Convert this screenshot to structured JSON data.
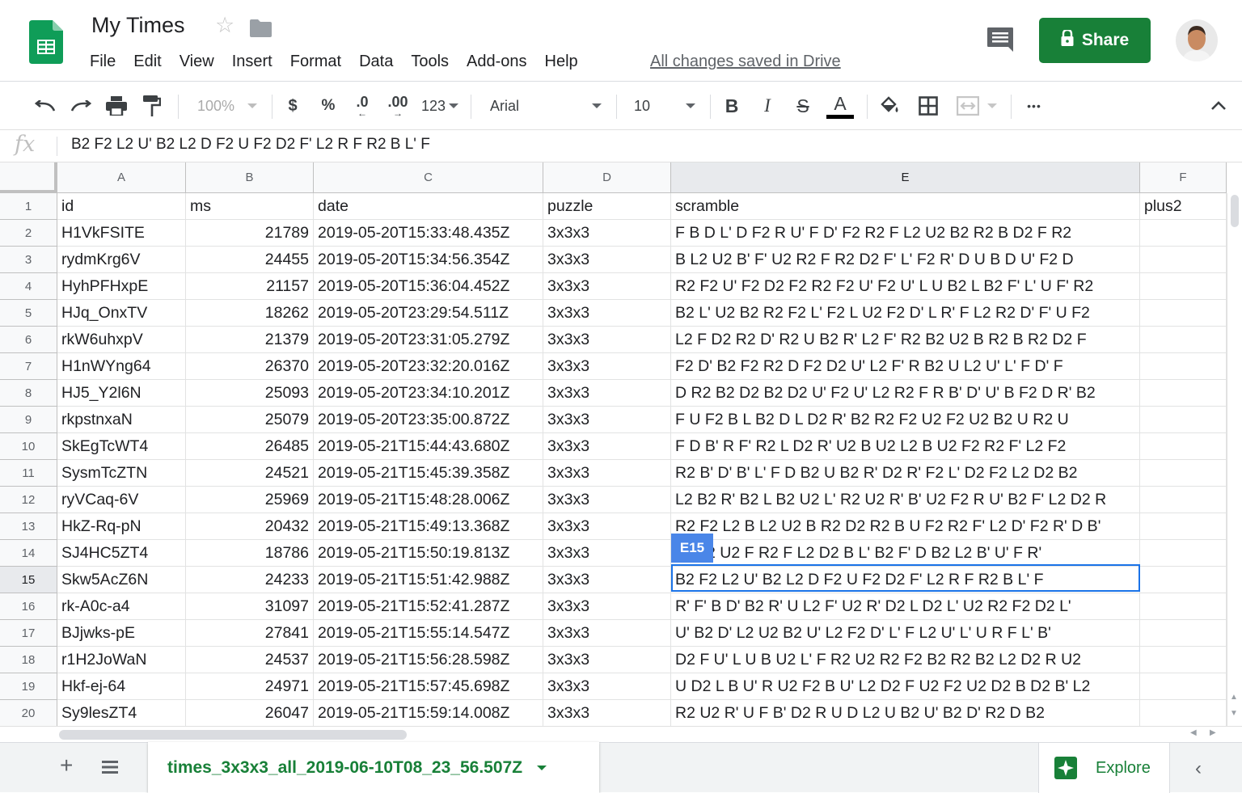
{
  "app": {
    "title": "My Times",
    "menu": [
      "File",
      "Edit",
      "View",
      "Insert",
      "Format",
      "Data",
      "Tools",
      "Add-ons",
      "Help"
    ],
    "saved_status": "All changes saved in Drive",
    "share_label": "Share",
    "colors": {
      "brand_green": "#188038",
      "selection_blue": "#1a73e8",
      "cell_tag_blue": "#4a86e8"
    }
  },
  "toolbar": {
    "zoom": "100%",
    "currency": "$",
    "percent": "%",
    "decrease_decimal": ".0",
    "increase_decimal": ".00",
    "more_formats": "123",
    "font": "Arial",
    "font_size": "10",
    "bold": "B",
    "italic": "I",
    "strikethrough": "S",
    "text_color": "A",
    "more": "•••"
  },
  "formula_bar": {
    "fx": "fx",
    "value": "B2 F2 L2 U' B2 L2 D F2 U F2 D2 F' L2 R F R2 B L' F"
  },
  "grid": {
    "columns": [
      "A",
      "B",
      "C",
      "D",
      "E",
      "F"
    ],
    "row_numbers": [
      "1",
      "2",
      "3",
      "4",
      "5",
      "6",
      "7",
      "8",
      "9",
      "10",
      "11",
      "12",
      "13",
      "14",
      "15",
      "16",
      "17",
      "18",
      "19",
      "20"
    ],
    "active_cell": "E15",
    "rows": [
      [
        "id",
        "ms",
        "date",
        "puzzle",
        "scramble",
        "plus2"
      ],
      [
        "H1VkFSITE",
        "21789",
        "2019-05-20T15:33:48.435Z",
        "3x3x3",
        "F B D L' D F2 R U' F D' F2 R2 F L2 U2 B2 R2 B D2 F R2",
        ""
      ],
      [
        "rydmKrg6V",
        "24455",
        "2019-05-20T15:34:56.354Z",
        "3x3x3",
        "B L2 U2 B' F' U2 R2 F R2 D2 F' L' F2 R' D U B D U' F2 D",
        ""
      ],
      [
        "HyhPFHxpE",
        "21157",
        "2019-05-20T15:36:04.452Z",
        "3x3x3",
        "R2 F2 U' F2 D2 F2 R2 F2 U' F2 U' L U B2 L B2 F' L' U F' R2",
        ""
      ],
      [
        "HJq_OnxTV",
        "18262",
        "2019-05-20T23:29:54.511Z",
        "3x3x3",
        "B2 L' U2 B2 R2 F2 L' F2 L U2 F2 D' L R' F L2 R2 D' F' U F2",
        ""
      ],
      [
        "rkW6uhxpV",
        "21379",
        "2019-05-20T23:31:05.279Z",
        "3x3x3",
        "L2 F D2 R2 D' R2 U B2 R' L2 F' R2 B2 U2 B R2 B R2 D2 F",
        ""
      ],
      [
        "H1nWYng64",
        "26370",
        "2019-05-20T23:32:20.016Z",
        "3x3x3",
        "F2 D' B2 F2 R2 D F2 D2 U' L2 F' R B2 U L2 U' L' F D' F",
        ""
      ],
      [
        "HJ5_Y2l6N",
        "25093",
        "2019-05-20T23:34:10.201Z",
        "3x3x3",
        "D R2 B2 D2 B2 D2 U' F2 U' L2 R2 F R B' D' U' B F2 D R' B2",
        ""
      ],
      [
        "rkpstnxaN",
        "25079",
        "2019-05-20T23:35:00.872Z",
        "3x3x3",
        "F U F2 B L B2 D L D2 R' B2 R2 F2 U2 F2 U2 B2 U R2 U",
        ""
      ],
      [
        "SkEgTcWT4",
        "26485",
        "2019-05-21T15:44:43.680Z",
        "3x3x3",
        "F D B' R F' R2 L D2 R' U2 B U2 L2 B U2 F2 R2 F' L2 F2",
        ""
      ],
      [
        "SysmTcZTN",
        "24521",
        "2019-05-21T15:45:39.358Z",
        "3x3x3",
        "R2 B' D' B' L' F D B2 U B2 R' D2 R' F2 L' D2 F2 L2 D2 B2",
        ""
      ],
      [
        "ryVCaq-6V",
        "25969",
        "2019-05-21T15:48:28.006Z",
        "3x3x3",
        "L2 B2 R' B2 L B2 U2 L' R2 U2 R' B' U2 F2 R U' B2 F' L2 D2 R",
        ""
      ],
      [
        "HkZ-Rq-pN",
        "20432",
        "2019-05-21T15:49:13.368Z",
        "3x3x3",
        "R2 F2 L2 B L2 U2 B R2 D2 R2 B U F2 R2 F' L2 D' F2 R' D B'",
        ""
      ],
      [
        "SJ4HC5ZT4",
        "18786",
        "2019-05-21T15:50:19.813Z",
        "3x3x3",
        "L2 F2 U2 F R2 F L2 D2 B L' B2 F' D B2 L2 B' U' F R'",
        ""
      ],
      [
        "Skw5AcZ6N",
        "24233",
        "2019-05-21T15:51:42.988Z",
        "3x3x3",
        "B2 F2 L2 U' B2 L2 D F2 U F2 D2 F' L2 R F R2 B L' F",
        ""
      ],
      [
        "rk-A0c-a4",
        "31097",
        "2019-05-21T15:52:41.287Z",
        "3x3x3",
        "R' F' B D' B2 R' U L2 F' U2 R' D2 L D2 L' U2 R2 F2 D2 L'",
        ""
      ],
      [
        "BJjwks-pE",
        "27841",
        "2019-05-21T15:55:14.547Z",
        "3x3x3",
        "U' B2 D' L2 U2 B2 U' L2 F2 D' L' F L2 U' L' U R F L' B'",
        ""
      ],
      [
        "r1H2JoWaN",
        "24537",
        "2019-05-21T15:56:28.598Z",
        "3x3x3",
        "D2 F U' L U B U2 L' F R2 U2 R2 F2 B2 R2 B2 L2 D2 R U2",
        ""
      ],
      [
        "Hkf-ej-64",
        "24971",
        "2019-05-21T15:57:45.698Z",
        "3x3x3",
        "U D2 L B U' R U2 F2 B U' L2 D2 F U2 F2 U2 D2 B D2 B' L2",
        ""
      ],
      [
        "Sy9lesZT4",
        "26047",
        "2019-05-21T15:59:14.008Z",
        "3x3x3",
        "R2 U2 R' U F B' D2 R U D L2 U B2 U' B2 D' R2 D B2",
        ""
      ]
    ]
  },
  "sheets": {
    "add_label": "+",
    "active_tab": "times_3x3x3_all_2019-06-10T08_23_56.507Z",
    "explore_label": "Explore"
  }
}
